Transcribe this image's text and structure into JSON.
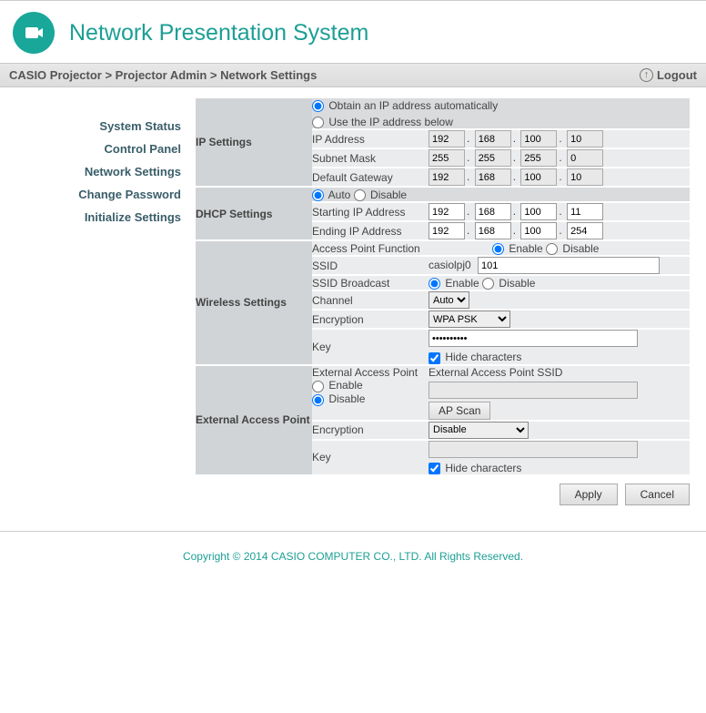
{
  "header": {
    "title": "Network Presentation System"
  },
  "breadcrumb": {
    "text": "CASIO Projector > Projector Admin > Network Settings",
    "logout": "Logout"
  },
  "sidebar": {
    "items": [
      {
        "label": "System Status"
      },
      {
        "label": "Control Panel"
      },
      {
        "label": "Network Settings"
      },
      {
        "label": "Change Password"
      },
      {
        "label": "Initialize Settings"
      }
    ]
  },
  "ip": {
    "section": "IP Settings",
    "obtain": "Obtain an IP address automatically",
    "use_below": "Use the IP address below",
    "ip_address_label": "IP Address",
    "ip_address": {
      "a": "192",
      "b": "168",
      "c": "100",
      "d": "10"
    },
    "subnet_label": "Subnet Mask",
    "subnet": {
      "a": "255",
      "b": "255",
      "c": "255",
      "d": "0"
    },
    "gateway_label": "Default Gateway",
    "gateway": {
      "a": "192",
      "b": "168",
      "c": "100",
      "d": "10"
    }
  },
  "dhcp": {
    "section": "DHCP Settings",
    "auto": "Auto",
    "disable": "Disable",
    "start_label": "Starting IP Address",
    "start": {
      "a": "192",
      "b": "168",
      "c": "100",
      "d": "11"
    },
    "end_label": "Ending IP Address",
    "end": {
      "a": "192",
      "b": "168",
      "c": "100",
      "d": "254"
    }
  },
  "wireless": {
    "section": "Wireless Settings",
    "apf_label": "Access Point Function",
    "enable": "Enable",
    "disable": "Disable",
    "ssid_label": "SSID",
    "ssid_prefix": "casiolpj0",
    "ssid_value": "101",
    "broadcast_label": "SSID Broadcast",
    "channel_label": "Channel",
    "channel_value": "Auto",
    "encryption_label": "Encryption",
    "encryption_value": "WPA PSK",
    "key_label": "Key",
    "key_value": "••••••••••",
    "hide_chars": "Hide characters"
  },
  "ext": {
    "section": "External Access Point",
    "eap_label": "External Access Point",
    "enable": "Enable",
    "disable": "Disable",
    "eap_ssid_label": "External Access Point SSID",
    "eap_ssid_value": "",
    "ap_scan": "AP Scan",
    "encryption_label": "Encryption",
    "encryption_value": "Disable",
    "key_label": "Key",
    "key_value": "",
    "hide_chars": "Hide characters"
  },
  "buttons": {
    "apply": "Apply",
    "cancel": "Cancel"
  },
  "footer": {
    "copyright": "Copyright © 2014 CASIO COMPUTER CO., LTD. All Rights Reserved."
  }
}
